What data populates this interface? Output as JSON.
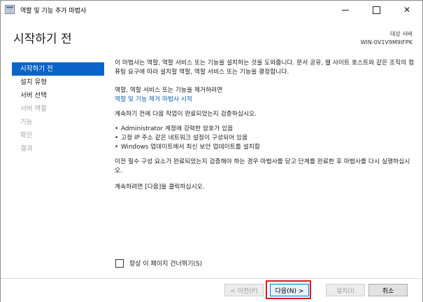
{
  "window": {
    "title": "역할 및 기능 추가 마법사",
    "controls": {
      "minimize": "—",
      "maximize": "☐",
      "close": "✕"
    }
  },
  "header": {
    "title": "시작하기 전",
    "target_label": "대상 서버",
    "target_value": "WIN-0V1V9M9IFPK"
  },
  "sidebar": {
    "items": [
      {
        "label": "시작하기 전",
        "state": "active"
      },
      {
        "label": "설치 유형",
        "state": "enabled"
      },
      {
        "label": "서버 선택",
        "state": "enabled"
      },
      {
        "label": "서버 역할",
        "state": "disabled"
      },
      {
        "label": "기능",
        "state": "disabled"
      },
      {
        "label": "확인",
        "state": "disabled"
      },
      {
        "label": "결과",
        "state": "disabled"
      }
    ]
  },
  "content": {
    "intro": "이 마법사는 역할, 역할 서비스 또는 기능을 설치하는 것을 도와줍니다. 문서 공유, 웹 사이트 호스트와 같은 조직의 컴퓨팅 요구에 따라 설치할 역할, 역할 서비스 또는 기능을 결정합니다.",
    "remove_text": "역할, 역할 서비스 또는 기능을 제거하려면",
    "remove_link": "역할 및 기능 제거 마법사 시작",
    "verify_text": "계속하기 전에 다음 작업이 완료되었는지 검증하십시오.",
    "bullet": "•",
    "tasks": [
      "Administrator 계정에 강력한 암호가 있음",
      "고정 IP 주소 같은 네트워크 설정이 구성되어 있음",
      "Windows 업데이트에서 최신 보안 업데이트를 설치함"
    ],
    "prereq_text": "이전 필수 구성 요소가 완료되었는지 검증해야 하는 경우 마법사를 닫고 단계를 완료한 후 마법사를 다시 실행하십시오.",
    "continue_text": "계속하려면 [다음]을 클릭하십시오."
  },
  "skip": {
    "label": "항상 이 페이지 건너뛰기(S)",
    "checked": false
  },
  "footer": {
    "prev_label": "< 이전(P)",
    "next_label": "다음(N) >",
    "install_label": "설치(I)",
    "cancel_label": "취소"
  },
  "colors": {
    "accent": "#0a64c8",
    "link": "#0c5fb3",
    "highlight": "#e01a1a"
  }
}
